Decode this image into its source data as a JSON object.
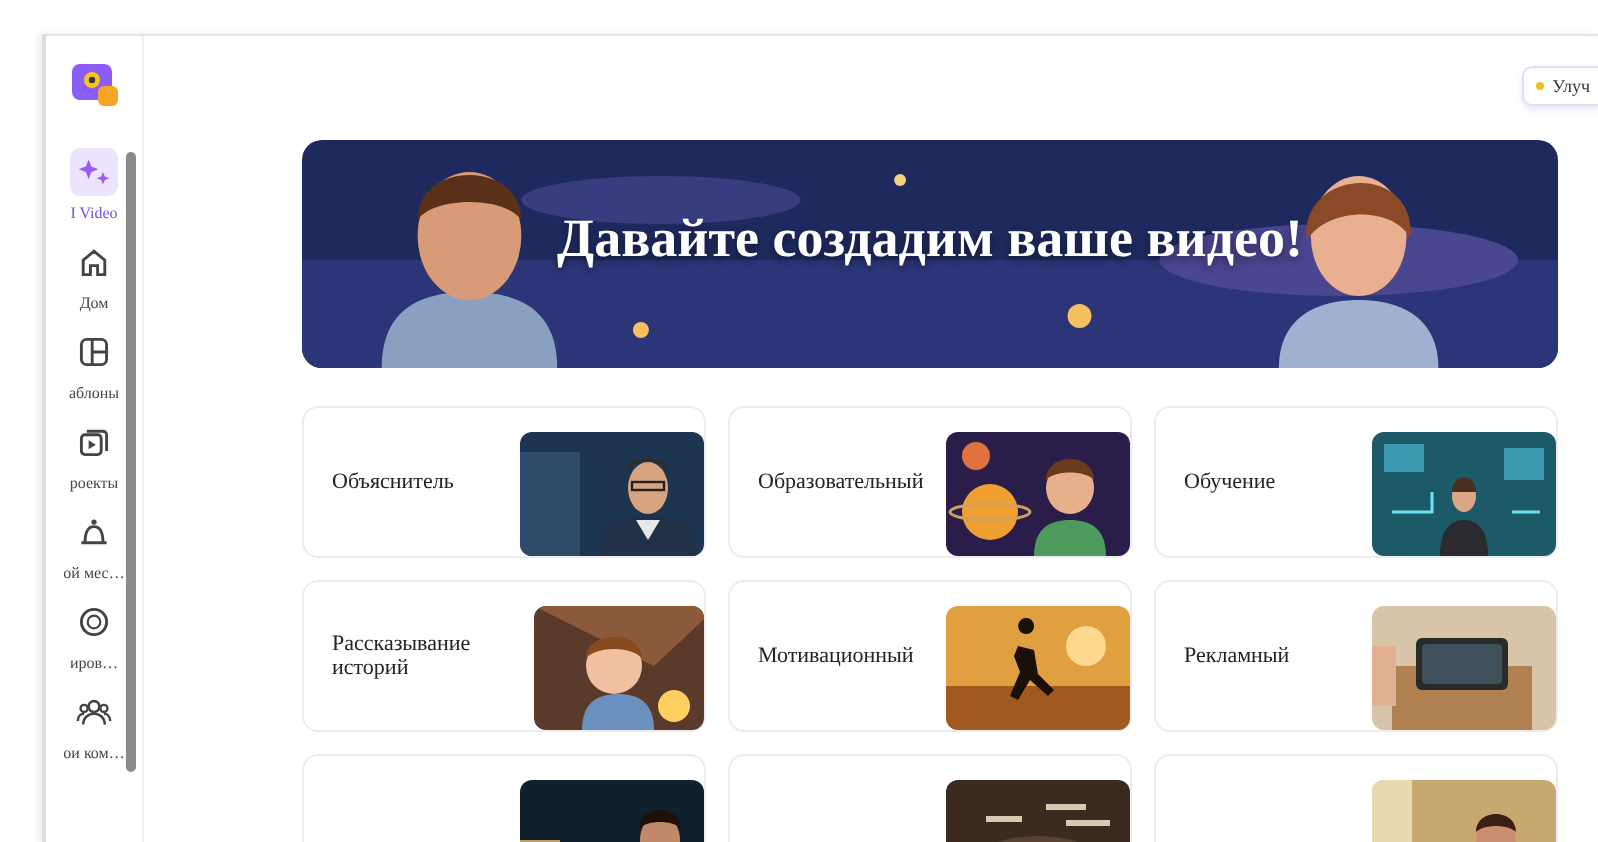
{
  "sidebar": {
    "items": [
      {
        "label": "I Video",
        "selected": true
      },
      {
        "label": "Дом",
        "selected": false
      },
      {
        "label": "аблоны",
        "selected": false
      },
      {
        "label": "роекты",
        "selected": false
      },
      {
        "label": "ой мес…",
        "selected": false
      },
      {
        "label": "иров…",
        "selected": false
      },
      {
        "label": "ои ком…",
        "selected": false
      }
    ]
  },
  "header": {
    "upgrade_button": "Улуч"
  },
  "banner": {
    "title": "Давайте создадим ваше видео!"
  },
  "categories": [
    {
      "label": "Объяснитель"
    },
    {
      "label": "Образовательный"
    },
    {
      "label": "Обучение"
    },
    {
      "label": "Рассказывание историй"
    },
    {
      "label": "Мотивационный"
    },
    {
      "label": "Рекламный"
    }
  ]
}
